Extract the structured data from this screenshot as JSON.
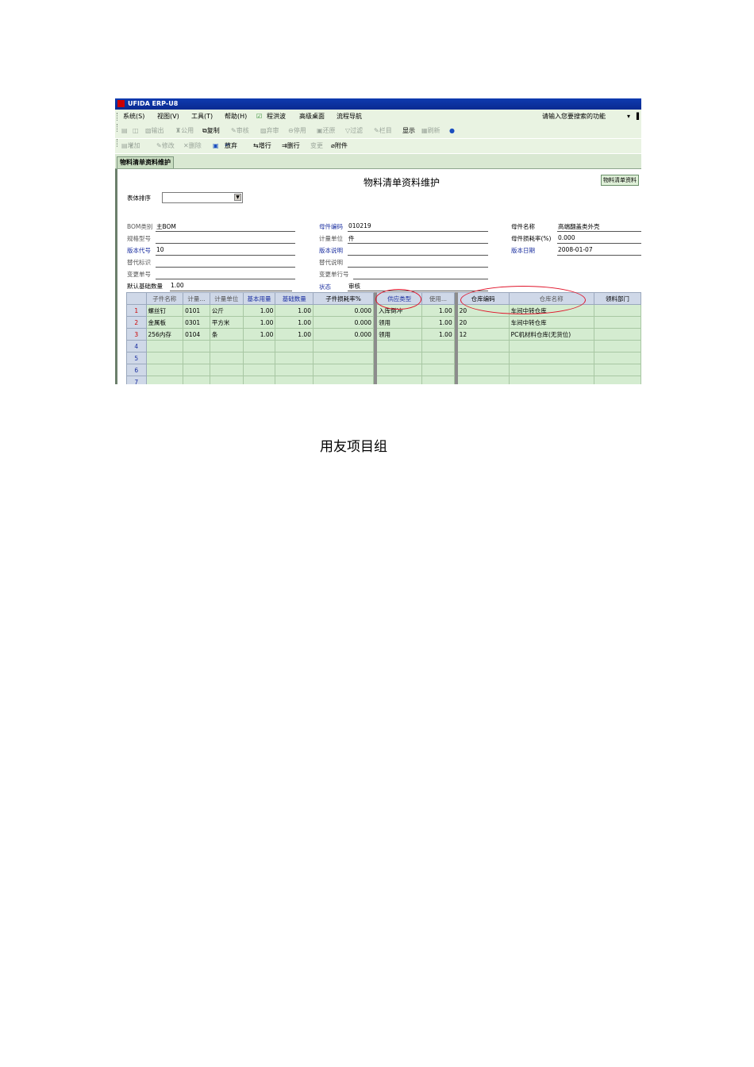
{
  "window": {
    "title": "UFIDA ERP-U8"
  },
  "menu": {
    "items": [
      "系统(S)",
      "视图(V)",
      "工具(T)",
      "帮助(H)",
      "程洪波",
      "高级桌面",
      "流程导航"
    ],
    "search_placeholder": "请输入您要搜索的功能"
  },
  "toolbar1": [
    "输出",
    "公用",
    "复制",
    "审核",
    "弃审",
    "停用",
    "还原",
    "过滤",
    "栏目",
    "显示",
    "刷新"
  ],
  "toolbar2": [
    "增加",
    "修改",
    "删除",
    "放弃",
    "增行",
    "删行",
    "变更",
    "附件"
  ],
  "tab": {
    "label": "物料清单资料维护"
  },
  "form": {
    "title": "物料清单资料维护",
    "badge": "物料清单资料",
    "sort_label": "表体排序",
    "fields": {
      "bom_type_label": "BOM类别",
      "bom_type": "主BOM",
      "parent_code_label": "母件编码",
      "parent_code": "010219",
      "parent_name_label": "母件名称",
      "parent_name": "高端翻盖类外壳",
      "spec_label": "规格型号",
      "spec": "",
      "unit_label": "计量单位",
      "unit": "件",
      "loss_rate_label": "母件损耗率(%)",
      "loss_rate": "0.000",
      "version_code_label": "版本代号",
      "version_code": "10",
      "version_desc_label": "版本说明",
      "version_desc": "",
      "version_date_label": "版本日期",
      "version_date": "2008-01-07",
      "alt_flag_label": "替代标识",
      "alt_flag": "",
      "alt_desc_label": "替代说明",
      "alt_desc": "",
      "change_no_label": "变更单号",
      "change_no": "",
      "change_line_label": "变更单行号",
      "change_line": "",
      "default_base_qty_label": "默认基础数量",
      "default_base_qty": "1.00",
      "status_label": "状态",
      "status": "审核"
    }
  },
  "grid": {
    "headers": [
      "子件名称",
      "计量...",
      "计量单位",
      "基本用量",
      "基础数量",
      "子件损耗率%",
      "供应类型",
      "使用...",
      "仓库编码",
      "仓库名称",
      "领料部门"
    ],
    "rows": [
      [
        "1",
        "螺丝钉",
        "0101",
        "公斤",
        "1.00",
        "1.00",
        "0.000",
        "入库倒冲",
        "1.00",
        "20",
        "车间中转仓库",
        ""
      ],
      [
        "2",
        "金属板",
        "0301",
        "平方米",
        "1.00",
        "1.00",
        "0.000",
        "领用",
        "1.00",
        "20",
        "车间中转仓库",
        ""
      ],
      [
        "3",
        "256内存",
        "0104",
        "条",
        "1.00",
        "1.00",
        "0.000",
        "领用",
        "1.00",
        "12",
        "PC机材料仓库(无货位)",
        ""
      ],
      [
        "4",
        "",
        "",
        "",
        "",
        "",
        "",
        "",
        "",
        "",
        "",
        ""
      ],
      [
        "5",
        "",
        "",
        "",
        "",
        "",
        "",
        "",
        "",
        "",
        "",
        ""
      ],
      [
        "6",
        "",
        "",
        "",
        "",
        "",
        "",
        "",
        "",
        "",
        "",
        ""
      ],
      [
        "7",
        "",
        "",
        "",
        "",
        "",
        "",
        "",
        "",
        "",
        "",
        ""
      ]
    ]
  },
  "caption": "用友项目组",
  "colors": {
    "titlebar": "#0f3bb0",
    "panel": "#e9f3e2",
    "grid_cell": "#d4ecd0",
    "highlight_oval": "#e0142a"
  }
}
